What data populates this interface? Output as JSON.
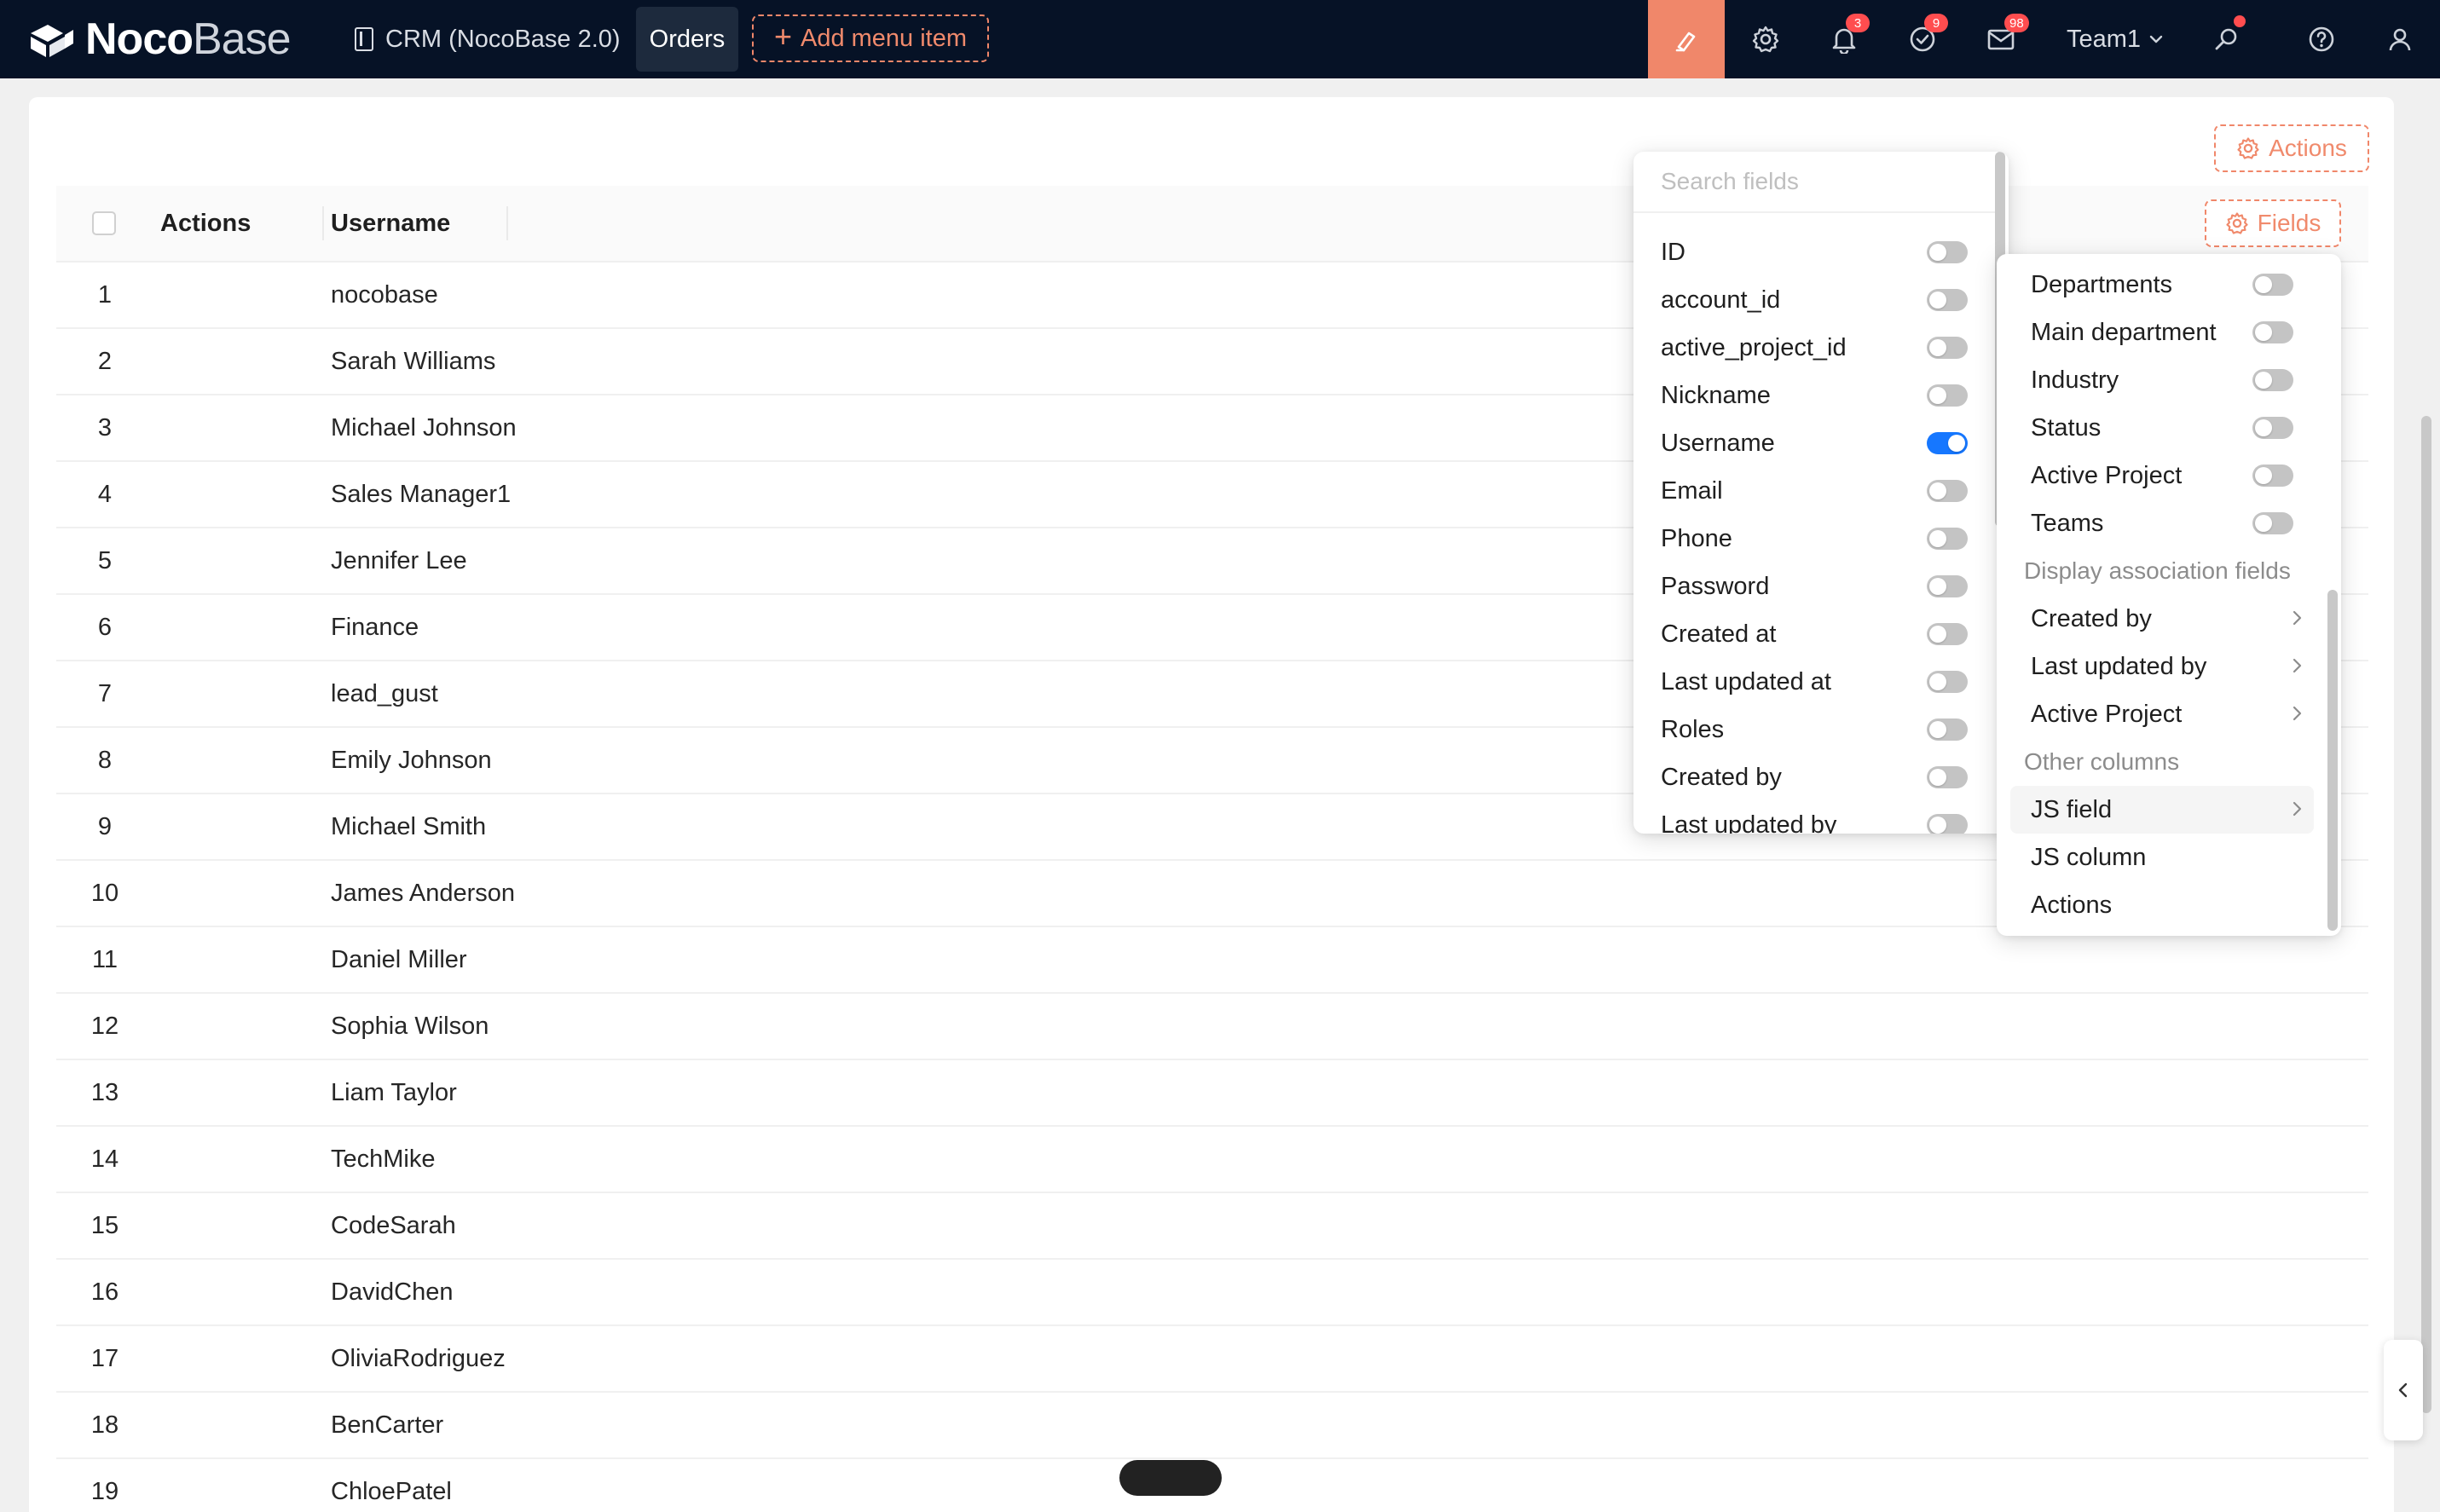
{
  "header": {
    "logo": {
      "bold": "Noco",
      "light": "Base"
    },
    "nav": {
      "crm_label": "CRM (NocoBase 2.0)",
      "orders_label": "Orders",
      "add_menu_label": "Add menu item"
    },
    "notifications_count": "3",
    "tasks_count": "9",
    "mail_count": "98",
    "team_label": "Team1",
    "accent_color": "#f0876a",
    "background_color": "#061226"
  },
  "toolbar": {
    "actions_label": "Actions",
    "fields_label": "Fields"
  },
  "table": {
    "columns": [
      "Actions",
      "Username"
    ],
    "rows": [
      {
        "index": "1",
        "username": "nocobase"
      },
      {
        "index": "2",
        "username": "Sarah Williams"
      },
      {
        "index": "3",
        "username": "Michael Johnson"
      },
      {
        "index": "4",
        "username": "Sales Manager1"
      },
      {
        "index": "5",
        "username": "Jennifer Lee"
      },
      {
        "index": "6",
        "username": "Finance"
      },
      {
        "index": "7",
        "username": "lead_gust"
      },
      {
        "index": "8",
        "username": "Emily Johnson"
      },
      {
        "index": "9",
        "username": "Michael Smith"
      },
      {
        "index": "10",
        "username": "James Anderson"
      },
      {
        "index": "11",
        "username": "Daniel Miller"
      },
      {
        "index": "12",
        "username": "Sophia Wilson"
      },
      {
        "index": "13",
        "username": "Liam Taylor"
      },
      {
        "index": "14",
        "username": "TechMike"
      },
      {
        "index": "15",
        "username": "CodeSarah"
      },
      {
        "index": "16",
        "username": "DavidChen"
      },
      {
        "index": "17",
        "username": "OliviaRodriguez"
      },
      {
        "index": "18",
        "username": "BenCarter"
      },
      {
        "index": "19",
        "username": "ChloePatel"
      }
    ]
  },
  "fields_panel": {
    "search_placeholder": "Search fields",
    "items": [
      {
        "label": "ID",
        "enabled": false
      },
      {
        "label": "account_id",
        "enabled": false
      },
      {
        "label": "active_project_id",
        "enabled": false
      },
      {
        "label": "Nickname",
        "enabled": false
      },
      {
        "label": "Username",
        "enabled": true
      },
      {
        "label": "Email",
        "enabled": false
      },
      {
        "label": "Phone",
        "enabled": false
      },
      {
        "label": "Password",
        "enabled": false
      },
      {
        "label": "Created at",
        "enabled": false
      },
      {
        "label": "Last updated at",
        "enabled": false
      },
      {
        "label": "Roles",
        "enabled": false
      },
      {
        "label": "Created by",
        "enabled": false
      },
      {
        "label": "Last updated by",
        "enabled": false
      }
    ]
  },
  "sub_panel": {
    "toggle_items": [
      {
        "label": "Departments",
        "enabled": false
      },
      {
        "label": "Main department",
        "enabled": false
      },
      {
        "label": "Industry",
        "enabled": false
      },
      {
        "label": "Status",
        "enabled": false
      },
      {
        "label": "Active Project",
        "enabled": false
      },
      {
        "label": "Teams",
        "enabled": false
      }
    ],
    "association_group_label": "Display association fields",
    "association_items": [
      "Created by",
      "Last updated by",
      "Active Project"
    ],
    "other_group_label": "Other columns",
    "other_items": [
      {
        "label": "JS field",
        "has_submenu": true,
        "active": true
      },
      {
        "label": "JS column",
        "has_submenu": false,
        "active": false
      },
      {
        "label": "Actions",
        "has_submenu": false,
        "active": false
      }
    ]
  }
}
